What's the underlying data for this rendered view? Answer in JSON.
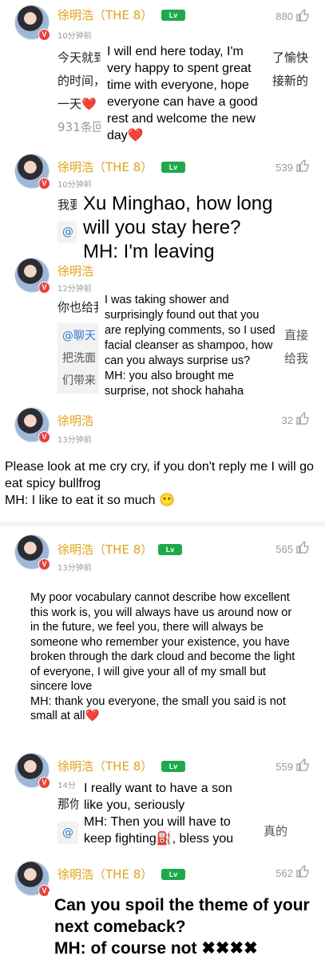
{
  "comments": [
    {
      "name": "徐明浩（THE 8）",
      "level": "Lv",
      "time": "10分钟前",
      "likes": "880",
      "body": [
        "今天就到",
        "的时间，",
        "一天❤️"
      ],
      "right_text": [
        "了愉快",
        "接新的"
      ],
      "replies": "931条回",
      "translation": "I will end here today, I'm very happy to spent great time with everyone, hope everyone can have a good rest and welcome the new day❤️"
    },
    {
      "name": "徐明浩（THE 8）",
      "level": "Lv",
      "time": "10分钟前",
      "likes": "539",
      "body": [
        "我要"
      ],
      "sub": "@",
      "translation": "Xu Minghao, how long will you stay here?\nMH: I'm leaving"
    },
    {
      "name": "徐明浩",
      "level": "Lv",
      "time": "12分钟前",
      "likes": "",
      "body": [
        "你也给我"
      ],
      "sub_lines": [
        "@聊天",
        "把洗面",
        "们带来"
      ],
      "right_text": [
        "直接",
        "给我"
      ],
      "translation": "I was taking shower and surprisingly found out that you are replying comments, so I used facial cleanser as shampoo, how can you always surprise us?\nMH: you also brought me surprise, not shock hahaha"
    },
    {
      "name": "徐明浩",
      "level": "Lv",
      "time": "13分钟前",
      "likes": "32",
      "translation": "Please look at me cry cry, if you don't reply me I will go eat spicy bullfrog\nMH: I like to eat it so much 😶"
    },
    {
      "name": "徐明浩（THE 8）",
      "level": "Lv",
      "time": "13分钟前",
      "likes": "565",
      "translation": "My poor vocabulary cannot describe how excellent this work is, you will always have us around now or in the future, we feel you, there will always be someone who remember your existence, you have broken through the dark cloud and become the light of everyone, I will give your all of my small but sincere love\nMH: thank you everyone, the small you said is not small at all❤️"
    },
    {
      "name": "徐明浩（THE 8）",
      "level": "Lv",
      "time": "14分",
      "likes": "559",
      "body": [
        "那你"
      ],
      "sub": "@",
      "right_text": [
        "真的"
      ],
      "translation": "I really want to have a son like you, seriously\nMH: Then you will have to keep fighting⛽, bless you"
    },
    {
      "name": "徐明浩（THE 8）",
      "level": "Lv",
      "likes": "562",
      "translation": "Can you spoil the theme of your next comeback?\nMH: of course not ✖✖✖✖"
    }
  ],
  "badge_letter": "V",
  "colors": {
    "name": "#e0a21a",
    "level": "#1fa94a",
    "badge": "#e8413b"
  }
}
